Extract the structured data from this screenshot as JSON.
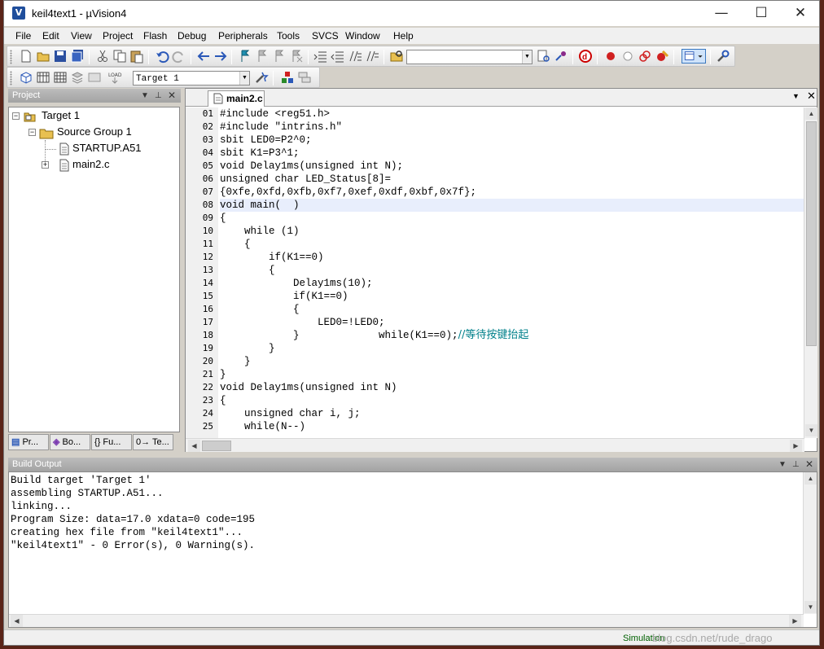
{
  "window": {
    "title": "keil4text1  - µVision4",
    "minimize": "—",
    "maximize": "☐",
    "close": "✕"
  },
  "menu": [
    "File",
    "Edit",
    "View",
    "Project",
    "Flash",
    "Debug",
    "Peripherals",
    "Tools",
    "SVCS",
    "Window",
    "Help"
  ],
  "toolbar": {
    "target_combo": "Target 1",
    "find_combo": ""
  },
  "project_panel": {
    "title": "Project",
    "tree": {
      "target": "Target 1",
      "group": "Source Group 1",
      "files": [
        "STARTUP.A51",
        "main2.c"
      ]
    },
    "tabs": [
      "Pr...",
      "Bo...",
      "{} Fu...",
      "0→ Te..."
    ]
  },
  "editor": {
    "tab": "main2.c",
    "line_numbers": [
      "01",
      "02",
      "03",
      "04",
      "05",
      "06",
      "07",
      "08",
      "09",
      "10",
      "11",
      "12",
      "13",
      "14",
      "15",
      "16",
      "17",
      "18",
      "19",
      "20",
      "21",
      "22",
      "23",
      "24",
      "25"
    ],
    "lines": [
      "#include <reg51.h>",
      "#include \"intrins.h\"",
      "sbit LED0=P2^0;",
      "sbit K1=P3^1;",
      "void Delay1ms(unsigned int N);",
      "unsigned char LED_Status[8]=",
      "{0xfe,0xfd,0xfb,0xf7,0xef,0xdf,0xbf,0x7f};",
      "void main(  )",
      "{",
      "    while (1)",
      "    {",
      "        if(K1==0)",
      "        {",
      "            Delay1ms(10);",
      "            if(K1==0)",
      "            {",
      "                LED0=!LED0;",
      "            }             while(K1==0);",
      "        }",
      "    }",
      "}",
      "void Delay1ms(unsigned int N)",
      "{",
      "    unsigned char i, j;",
      "    while(N--)"
    ],
    "comment_line18": "//等待按键抬起",
    "highlighted_line": "08"
  },
  "build_output": {
    "title": "Build Output",
    "lines": [
      "Build target 'Target 1'",
      "assembling STARTUP.A51...",
      "linking...",
      "Program Size: data=17.0 xdata=0 code=195",
      "creating hex file from \"keil4text1\"...",
      "\"keil4text1\" - 0 Error(s), 0 Warning(s)."
    ]
  },
  "status_bar": {
    "mode": "Simulation",
    "watermark": "blog.csdn.net/rude_drago"
  }
}
